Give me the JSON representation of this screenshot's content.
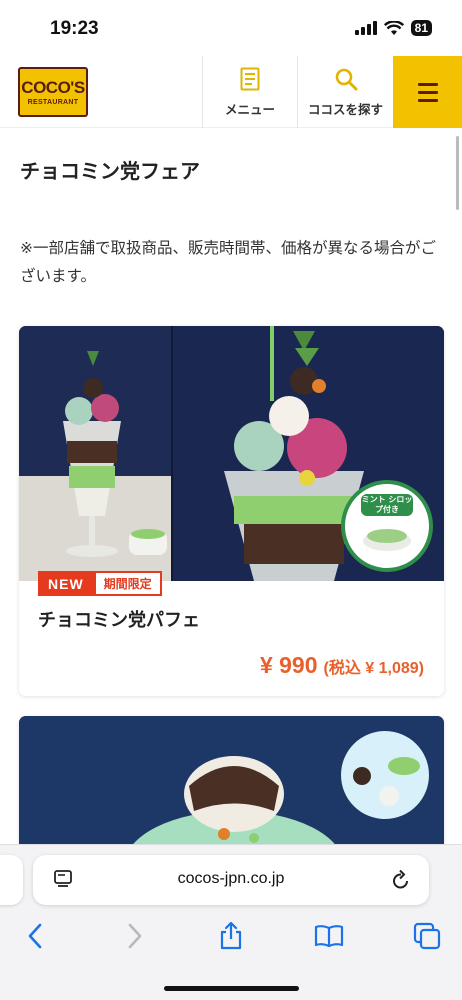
{
  "status_bar": {
    "time": "19:23",
    "battery": "81"
  },
  "header": {
    "logo_main": "COCO'S",
    "logo_sub": "RESTAURANT",
    "nav": [
      {
        "label": "メニュー",
        "icon": "menu-document-icon"
      },
      {
        "label": "ココスを探す",
        "icon": "search-icon"
      }
    ],
    "hamburger_icon": "hamburger-menu-icon",
    "brand_color": "#f2c200",
    "brand_dark": "#5a1d10"
  },
  "main": {
    "title": "チョコミン党フェア",
    "notice": "※一部店舗で取扱商品、販売時間帯、価格が異なる場合がございます。",
    "products": [
      {
        "badge_new": "NEW",
        "badge_limited": "期間限定",
        "name": "チョコミン党パフェ",
        "price": "¥ 990",
        "price_tax": "(税込 ¥ 1,089)",
        "image_label": "ミント シロップ付き"
      }
    ]
  },
  "browser": {
    "url": "cocos-jpn.co.jp",
    "toolbar": [
      "back-icon",
      "forward-icon",
      "share-icon",
      "bookmarks-icon",
      "tabs-icon"
    ]
  },
  "colors": {
    "accent_price": "#e8612c",
    "badge_red": "#e63a1e"
  }
}
